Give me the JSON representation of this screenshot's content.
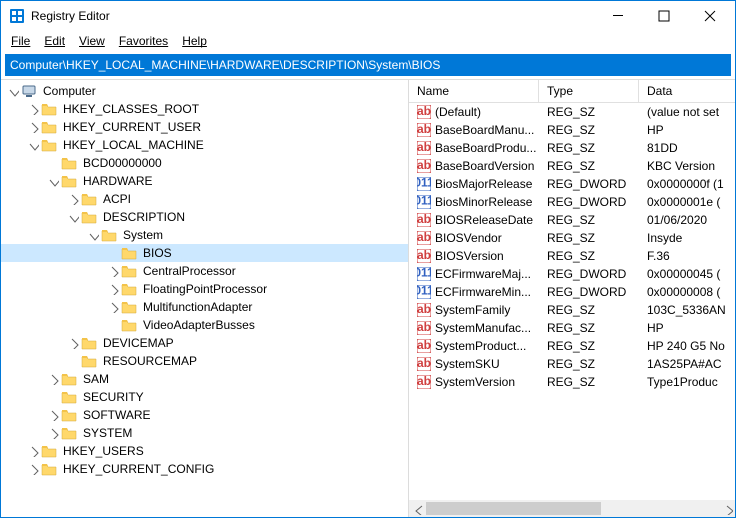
{
  "window": {
    "title": "Registry Editor"
  },
  "menu": {
    "file": "File",
    "edit": "Edit",
    "view": "View",
    "favorites": "Favorites",
    "help": "Help"
  },
  "address": "Computer\\HKEY_LOCAL_MACHINE\\HARDWARE\\DESCRIPTION\\System\\BIOS",
  "tree": {
    "root": "Computer",
    "hkcr": "HKEY_CLASSES_ROOT",
    "hkcu": "HKEY_CURRENT_USER",
    "hklm": "HKEY_LOCAL_MACHINE",
    "bcd": "BCD00000000",
    "hardware": "HARDWARE",
    "acpi": "ACPI",
    "description": "DESCRIPTION",
    "system": "System",
    "bios": "BIOS",
    "centralprocessor": "CentralProcessor",
    "fpp": "FloatingPointProcessor",
    "mfa": "MultifunctionAdapter",
    "vab": "VideoAdapterBusses",
    "devicemap": "DEVICEMAP",
    "resourcemap": "RESOURCEMAP",
    "sam": "SAM",
    "security": "SECURITY",
    "software": "SOFTWARE",
    "systemhk": "SYSTEM",
    "hku": "HKEY_USERS",
    "hkcc": "HKEY_CURRENT_CONFIG"
  },
  "columns": {
    "name": "Name",
    "type": "Type",
    "data": "Data"
  },
  "rows": [
    {
      "icon": "sz",
      "name": "(Default)",
      "type": "REG_SZ",
      "data": "(value not set"
    },
    {
      "icon": "sz",
      "name": "BaseBoardManu...",
      "type": "REG_SZ",
      "data": "HP"
    },
    {
      "icon": "sz",
      "name": "BaseBoardProdu...",
      "type": "REG_SZ",
      "data": "81DD"
    },
    {
      "icon": "sz",
      "name": "BaseBoardVersion",
      "type": "REG_SZ",
      "data": "KBC Version "
    },
    {
      "icon": "dw",
      "name": "BiosMajorRelease",
      "type": "REG_DWORD",
      "data": "0x0000000f (1"
    },
    {
      "icon": "dw",
      "name": "BiosMinorRelease",
      "type": "REG_DWORD",
      "data": "0x0000001e ("
    },
    {
      "icon": "sz",
      "name": "BIOSReleaseDate",
      "type": "REG_SZ",
      "data": "01/06/2020"
    },
    {
      "icon": "sz",
      "name": "BIOSVendor",
      "type": "REG_SZ",
      "data": "Insyde"
    },
    {
      "icon": "sz",
      "name": "BIOSVersion",
      "type": "REG_SZ",
      "data": "F.36"
    },
    {
      "icon": "dw",
      "name": "ECFirmwareMaj...",
      "type": "REG_DWORD",
      "data": "0x00000045 ("
    },
    {
      "icon": "dw",
      "name": "ECFirmwareMin...",
      "type": "REG_DWORD",
      "data": "0x00000008 ("
    },
    {
      "icon": "sz",
      "name": "SystemFamily",
      "type": "REG_SZ",
      "data": "103C_5336AN"
    },
    {
      "icon": "sz",
      "name": "SystemManufac...",
      "type": "REG_SZ",
      "data": "HP"
    },
    {
      "icon": "sz",
      "name": "SystemProduct...",
      "type": "REG_SZ",
      "data": "HP 240 G5 No"
    },
    {
      "icon": "sz",
      "name": "SystemSKU",
      "type": "REG_SZ",
      "data": "1AS25PA#AC"
    },
    {
      "icon": "sz",
      "name": "SystemVersion",
      "type": "REG_SZ",
      "data": "Type1Produc"
    }
  ]
}
